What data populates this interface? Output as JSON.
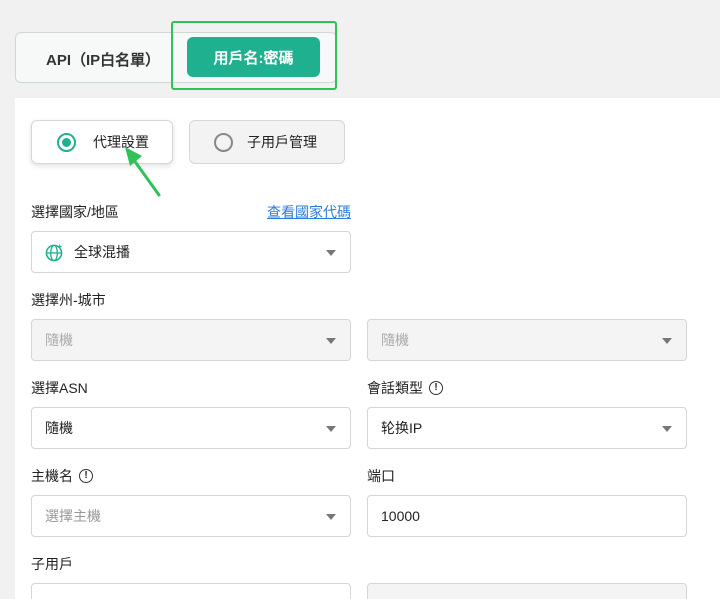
{
  "tabs": {
    "api_label": "API（IP白名單）",
    "userpass_label": "用戶名:密碼"
  },
  "modes": {
    "proxy_settings": "代理設置",
    "sub_user_mgmt": "子用戶管理"
  },
  "form": {
    "country_label": "選擇國家/地區",
    "country_codes_link": "查看國家代碼",
    "country_value": "全球混播",
    "state_city_label": "選擇州-城市",
    "state_value": "隨機",
    "city_value": "隨機",
    "asn_label": "選擇ASN",
    "asn_value": "隨機",
    "session_label": "會話類型",
    "session_value": "轮换IP",
    "host_label": "主機名",
    "host_placeholder": "選擇主機",
    "port_label": "端口",
    "port_value": "10000",
    "subuser_label": "子用戶"
  },
  "colors": {
    "accent": "#1fb08f",
    "highlight_box": "#2fc25b",
    "link": "#2a7de1"
  }
}
